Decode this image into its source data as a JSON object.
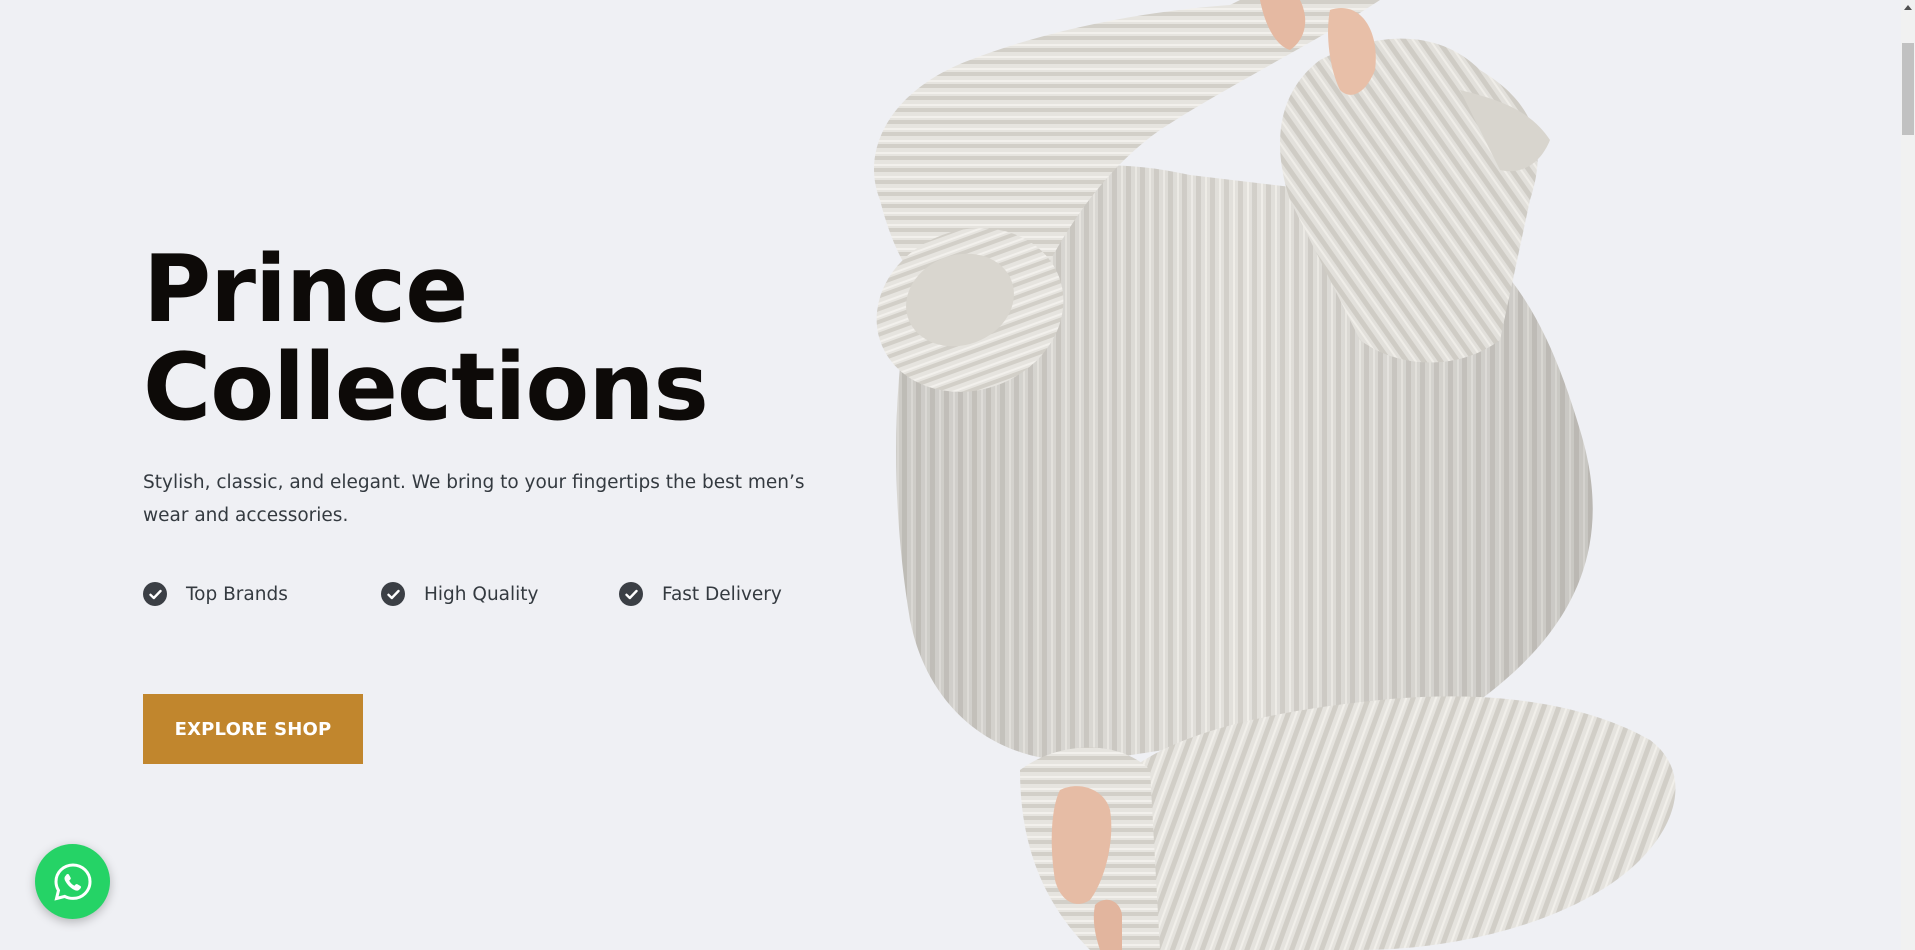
{
  "hero": {
    "title_line1": "Prince",
    "title_line2": "Collections",
    "subtitle": "Stylish, classic, and elegant. We bring to your fingertips the best men’s wear and accessories.",
    "features": [
      {
        "label": "Top Brands",
        "icon": "check-circle-icon"
      },
      {
        "label": "High Quality",
        "icon": "check-circle-icon"
      },
      {
        "label": "Fast Delivery",
        "icon": "check-circle-icon"
      }
    ],
    "cta_label": "EXPLORE SHOP"
  },
  "colors": {
    "background": "#eff0f4",
    "title": "#0d0a08",
    "body_text": "#343a40",
    "accent": "#c1862d",
    "whatsapp": "#25d366"
  },
  "icons": {
    "whatsapp": "whatsapp-icon",
    "scroll_up": "scroll-up-arrow-icon"
  }
}
